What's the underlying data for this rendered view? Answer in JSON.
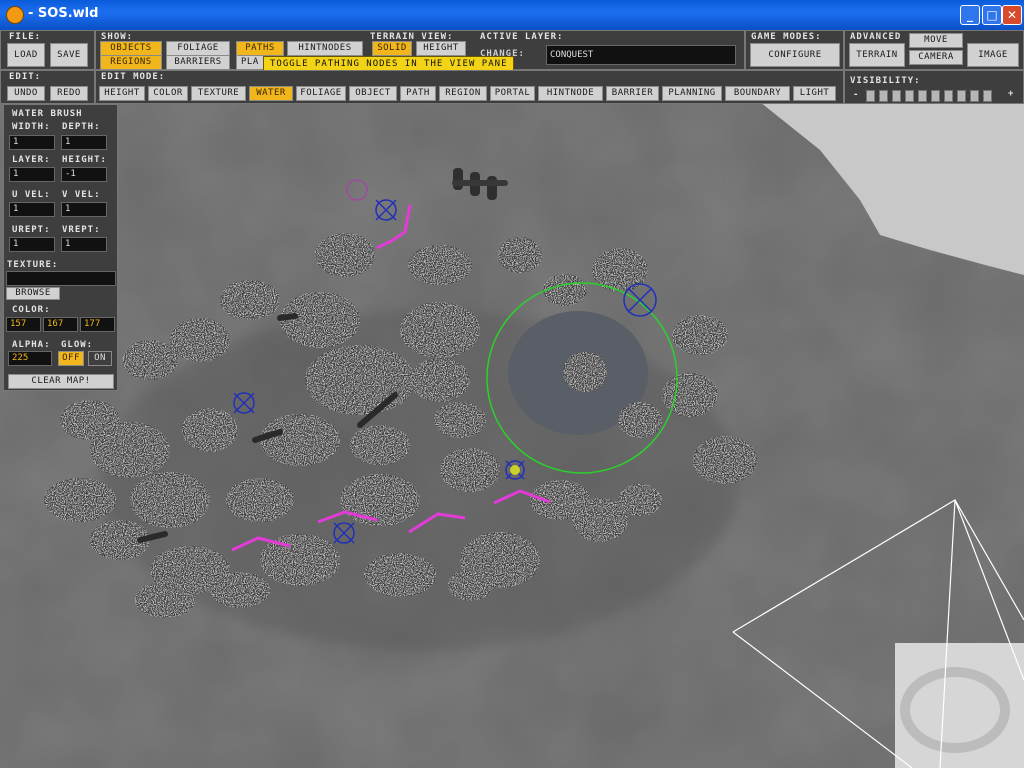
{
  "window": {
    "title": "- SOS.wld",
    "minimize": "_",
    "maximize": "□",
    "close": "✕"
  },
  "file": {
    "label": "File:",
    "load": "Load",
    "save": "Save"
  },
  "show": {
    "label": "Show:",
    "objects": "Objects",
    "foliage": "Foliage",
    "paths": "Paths",
    "hintnodes": "HintNodes",
    "regions": "Regions",
    "barriers": "Barriers",
    "planning": "Pla"
  },
  "terrain_view": {
    "label": "Terrain View:",
    "solid": "Solid",
    "height": "Height"
  },
  "active_layer": {
    "label": "Active Layer:",
    "change": "Change:",
    "value": "conquest"
  },
  "game_modes": {
    "label": "Game Modes:",
    "configure": "Configure"
  },
  "advanced": {
    "label": "Advanced",
    "terrain": "Terrain",
    "move": "Move",
    "camera": "Camera",
    "image": "Image"
  },
  "tooltip": "Toggle Pathing Nodes in the view pane",
  "edit": {
    "label": "Edit:",
    "undo": "Undo",
    "redo": "Redo"
  },
  "edit_mode": {
    "label": "Edit Mode:",
    "modes": [
      "Height",
      "Color",
      "Texture",
      "Water",
      "Foliage",
      "Object",
      "Path",
      "Region",
      "Portal",
      "HintNode",
      "Barrier",
      "Planning",
      "Boundary",
      "Light"
    ],
    "active": "Water"
  },
  "visibility": {
    "label": "Visibility:",
    "minus": "-",
    "plus": "+"
  },
  "brush": {
    "title": "Water Brush",
    "width_label": "Width:",
    "width": "1",
    "depth_label": "Depth:",
    "depth": "1",
    "layer_label": "Layer:",
    "layer": "1",
    "height_label": "Height:",
    "height": "-1",
    "uvel_label": "U Vel:",
    "uvel": "1",
    "vvel_label": "V Vel:",
    "vvel": "1",
    "urept_label": "URept:",
    "urept": "1",
    "vrept_label": "VRept:",
    "vrept": "1",
    "texture_label": "Texture:",
    "texture": "",
    "browse": "Browse",
    "color_label": "Color:",
    "color_r": "157",
    "color_g": "167",
    "color_b": "177",
    "alpha_label": "Alpha:",
    "alpha": "225",
    "glow_label": "Glow:",
    "glow_off": "Off",
    "glow_on": "On",
    "clear": "Clear Map!"
  },
  "colors": {
    "accent": "#f0b61b",
    "path": "#e23bd8",
    "ring": "#2bd12b",
    "water": "#5a5e66"
  }
}
